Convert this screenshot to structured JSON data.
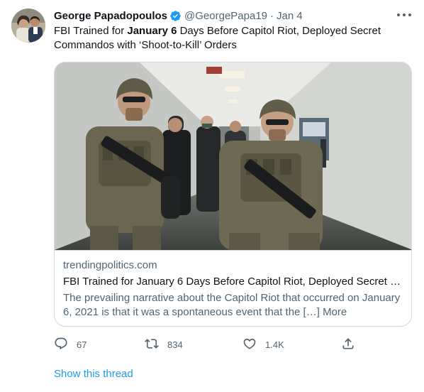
{
  "tweet": {
    "author_name": "George Papadopoulos",
    "handle": "@GeorgePapa19",
    "separator": "·",
    "time": "Jan 4",
    "text_part1": "FBI Trained for ",
    "text_bold": "January 6",
    "text_part2": " Days Before Capitol Riot, Deployed Secret Commandos with ‘Shoot-to-Kill’ Orders"
  },
  "card": {
    "domain": "trendingpolitics.com",
    "title": "FBI Trained for January 6 Days Before Capitol Riot, Deployed Secret C…",
    "description": "The prevailing narrative about the Capitol Riot that occurred on January 6, 2021 is that it was a spontaneous event that the […] More"
  },
  "actions": {
    "reply_count": "67",
    "retweet_count": "834",
    "like_count": "1.4K"
  },
  "show_thread": "Show this thread",
  "colors": {
    "accent": "#1d9bf0",
    "text_primary": "#0f1419",
    "text_secondary": "#536471",
    "border": "#cfd9de"
  },
  "icons": [
    "verified-badge-icon",
    "more-options-icon",
    "reply-icon",
    "retweet-icon",
    "like-icon",
    "share-icon"
  ]
}
